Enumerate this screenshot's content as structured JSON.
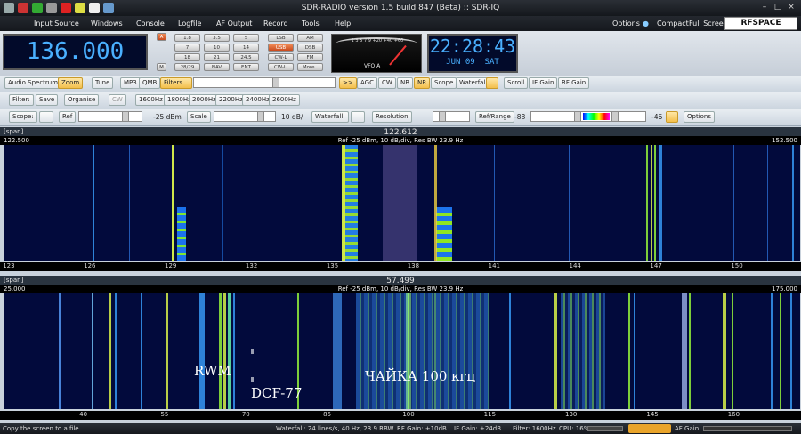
{
  "window": {
    "title": "SDR-RADIO version 1.5 build 847 (Beta) :: SDR-IQ"
  },
  "menu": {
    "items": [
      "Input Source",
      "Windows",
      "Console",
      "Logfile",
      "AF Output",
      "Record",
      "Tools",
      "Help"
    ],
    "right": {
      "options": "Options",
      "compact": "Compact",
      "full_screen": "Full Screen",
      "logo": "RFSPACE"
    }
  },
  "frequency_display": "136.000",
  "mode_buttons": [
    [
      "1.8",
      "3.5",
      "5"
    ],
    [
      "7",
      "10",
      "14"
    ],
    [
      "18",
      "21",
      "24.5"
    ],
    [
      "28/29",
      "NAV",
      "ENT"
    ]
  ],
  "modes_col1": [
    "LSB",
    "USB",
    "CW-L",
    "CW-U"
  ],
  "modes_col2": [
    "AM",
    "DSB",
    "FM",
    "More.."
  ],
  "small_buttons": {
    "a": "A",
    "m": "M"
  },
  "meter": {
    "label": "VFO A",
    "scale": "1 3 5 7 9 +20 +40 +60"
  },
  "clock": {
    "time": "22:28:43",
    "date": "JUN 09  SAT"
  },
  "toolbar1": {
    "items": [
      "Audio Spectrum",
      "Zoom",
      "Tune",
      "MP3",
      "QMB",
      "Filters...",
      ">>",
      "AGC",
      "CW",
      "NB",
      "NR",
      "Scope",
      "Waterfall",
      "Scroll",
      "IF Gain",
      "RF Gain"
    ]
  },
  "toolbar2": {
    "filter_label": "Filter:",
    "save": "Save",
    "organise": "Organise",
    "cw": "CW",
    "filters": [
      "1600Hz",
      "1800Hz",
      "2000Hz",
      "2200Hz",
      "2400Hz",
      "2600Hz"
    ]
  },
  "toolbar3": {
    "scope_label": "Scope:",
    "ref_label": "Ref",
    "ref_value": "-25 dBm",
    "scale_label": "Scale",
    "scale_value": "10 dB/",
    "waterfall_label": "Waterfall:",
    "resolution_label": "Resolution",
    "refrange_label": "Ref/Range",
    "ref_low": "-88",
    "ref_high": "-46",
    "options": "Options"
  },
  "panel1": {
    "span_label": "[span]",
    "center": "122.612",
    "left": "122.500",
    "right": "152.500",
    "info": "Ref -25 dBm,  10 dB/div,  Res BW 23.9 Hz",
    "ticks": [
      "123",
      "126",
      "129",
      "132",
      "135",
      "138",
      "141",
      "144",
      "147",
      "150"
    ]
  },
  "panel2": {
    "span_label": "[span]",
    "center": "57.499",
    "left": "25.000",
    "right": "175.000",
    "info": "Ref -25 dBm,  10 dB/div,  Res BW 23.9 Hz",
    "ticks": [
      "40",
      "55",
      "70",
      "85",
      "100",
      "115",
      "130",
      "145",
      "160"
    ],
    "labels": {
      "rwm": "RWM",
      "dcf": "DCF-77",
      "chaika": "ЧАЙКА 100 кгц"
    }
  },
  "status": {
    "hint": "Copy the screen to a file",
    "waterfall": "Waterfall: 24 lines/s, 40 Hz, 23.9 RBW",
    "rf_gain": "RF Gain: +10dB",
    "if_gain": "IF Gain: +24dB",
    "filter": "Filter: 1600Hz",
    "cpu": "CPU: 16%",
    "af_gain": "AF Gain"
  },
  "colors": {
    "accent": "#f3bf4c",
    "lcd_text": "#4ab0ff",
    "waterfall_bg": "#020a3c",
    "signal": "#9cff3a"
  }
}
